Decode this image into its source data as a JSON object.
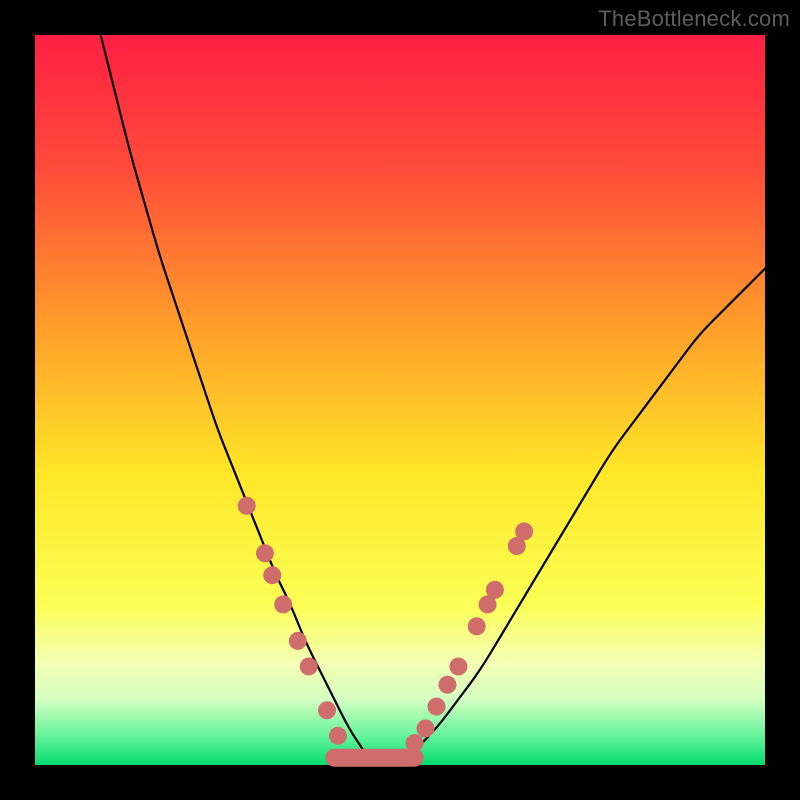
{
  "attribution": "TheBottleneck.com",
  "chart_data": {
    "type": "line",
    "title": "",
    "xlabel": "",
    "ylabel": "",
    "xlim": [
      0,
      100
    ],
    "ylim": [
      0,
      100
    ],
    "grid": false,
    "legend": false,
    "background_gradient_stops": [
      {
        "offset": 0.0,
        "color": "#ff1f44"
      },
      {
        "offset": 0.18,
        "color": "#ff4a3a"
      },
      {
        "offset": 0.4,
        "color": "#ff9e2a"
      },
      {
        "offset": 0.6,
        "color": "#ffe628"
      },
      {
        "offset": 0.78,
        "color": "#fbff55"
      },
      {
        "offset": 0.86,
        "color": "#f4ffb3"
      },
      {
        "offset": 0.91,
        "color": "#d4ffc1"
      },
      {
        "offset": 0.96,
        "color": "#66f49d"
      },
      {
        "offset": 1.0,
        "color": "#04da6e"
      }
    ],
    "series": [
      {
        "name": "left-branch",
        "stroke": "#000000",
        "x": [
          9,
          11,
          13,
          15,
          17,
          19,
          21,
          23,
          25,
          27,
          29,
          31,
          33,
          35,
          37,
          39,
          41,
          43,
          45
        ],
        "values": [
          100,
          92,
          84,
          77,
          70,
          64,
          58,
          52,
          46,
          41,
          36,
          31,
          26,
          22,
          17,
          13,
          9,
          5,
          2
        ]
      },
      {
        "name": "right-branch",
        "stroke": "#000000",
        "x": [
          52,
          55,
          58,
          61,
          64,
          67,
          70,
          73,
          76,
          79,
          82,
          85,
          88,
          91,
          94,
          97,
          100
        ],
        "values": [
          2,
          5,
          9,
          13,
          18,
          23,
          28,
          33,
          38,
          43,
          47,
          51,
          55,
          59,
          62,
          65,
          68
        ]
      },
      {
        "name": "flat-bottom",
        "stroke": "#cf6d6c",
        "stroke_width": 18,
        "x": [
          41,
          52
        ],
        "values": [
          1,
          1
        ]
      }
    ],
    "markers": {
      "color": "#cf6d6c",
      "radius_px": 9,
      "points": [
        {
          "x": 29.0,
          "y": 35.5
        },
        {
          "x": 31.5,
          "y": 29.0
        },
        {
          "x": 32.5,
          "y": 26.0
        },
        {
          "x": 34.0,
          "y": 22.0
        },
        {
          "x": 36.0,
          "y": 17.0
        },
        {
          "x": 37.5,
          "y": 13.5
        },
        {
          "x": 40.0,
          "y": 7.5
        },
        {
          "x": 41.5,
          "y": 4.0
        },
        {
          "x": 52.0,
          "y": 3.0
        },
        {
          "x": 53.5,
          "y": 5.0
        },
        {
          "x": 55.0,
          "y": 8.0
        },
        {
          "x": 56.5,
          "y": 11.0
        },
        {
          "x": 58.0,
          "y": 13.5
        },
        {
          "x": 60.5,
          "y": 19.0
        },
        {
          "x": 62.0,
          "y": 22.0
        },
        {
          "x": 63.0,
          "y": 24.0
        },
        {
          "x": 66.0,
          "y": 30.0
        },
        {
          "x": 67.0,
          "y": 32.0
        }
      ]
    }
  }
}
